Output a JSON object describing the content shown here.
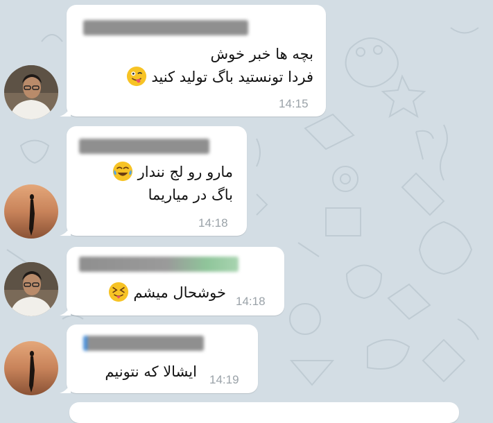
{
  "chat": {
    "background_color": "#d3dde4",
    "messages": [
      {
        "lines": [
          "بچه ها خبر خوش",
          "فردا تونستید باگ تولید کنید"
        ],
        "emoji": "face-with-tongue-wink",
        "time": "14:15",
        "avatar": "person-with-glasses"
      },
      {
        "lines": [
          "مارو رو لج نندار",
          "باگ در میاریما"
        ],
        "emoji": "face-with-tears-of-joy",
        "time": "14:18",
        "avatar": "silhouette-sunset"
      },
      {
        "lines": [
          "خوشحال میشم"
        ],
        "emoji": "squinting-face-with-tongue",
        "time": "14:18",
        "avatar": "person-with-glasses"
      },
      {
        "lines": [
          "ایشالا که نتونیم"
        ],
        "time": "14:19",
        "avatar": "silhouette-sunset"
      }
    ]
  }
}
